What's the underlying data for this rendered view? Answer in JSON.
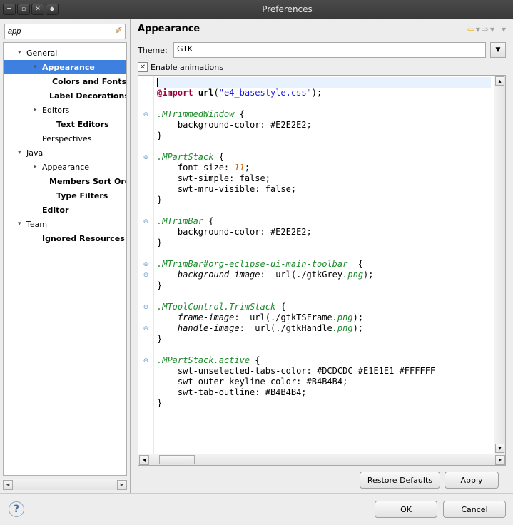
{
  "window": {
    "title": "Preferences"
  },
  "filter": {
    "value": "app"
  },
  "tree": [
    {
      "label": "General",
      "level": 1,
      "twisty": "▾",
      "interact": true,
      "bold": false
    },
    {
      "label": "Appearance",
      "level": 2,
      "twisty": "▾",
      "interact": true,
      "bold": true,
      "selected": true
    },
    {
      "label": "Colors and Fonts",
      "level": 3,
      "twisty": "",
      "interact": true,
      "bold": true
    },
    {
      "label": "Label Decorations",
      "level": 3,
      "twisty": "",
      "interact": true,
      "bold": true
    },
    {
      "label": "Editors",
      "level": 2,
      "twisty": "▸",
      "interact": true,
      "bold": false
    },
    {
      "label": "Text Editors",
      "level": 3,
      "twisty": "",
      "interact": true,
      "bold": true
    },
    {
      "label": "Perspectives",
      "level": 2,
      "twisty": "",
      "interact": true,
      "bold": false
    },
    {
      "label": "Java",
      "level": 1,
      "twisty": "▾",
      "interact": true,
      "bold": false
    },
    {
      "label": "Appearance",
      "level": 2,
      "twisty": "▸",
      "interact": true,
      "bold": false
    },
    {
      "label": "Members Sort Order",
      "level": 3,
      "twisty": "",
      "interact": true,
      "bold": true
    },
    {
      "label": "Type Filters",
      "level": 3,
      "twisty": "",
      "interact": true,
      "bold": true
    },
    {
      "label": "Editor",
      "level": 2,
      "twisty": "",
      "interact": true,
      "bold": true
    },
    {
      "label": "Team",
      "level": 1,
      "twisty": "▾",
      "interact": true,
      "bold": false
    },
    {
      "label": "Ignored Resources",
      "level": 2,
      "twisty": "",
      "interact": true,
      "bold": true
    }
  ],
  "page": {
    "title": "Appearance",
    "theme_label": "Theme:",
    "theme_value": "GTK",
    "enable_anim_prefix": "E",
    "enable_anim_rest": "nable animations",
    "enable_anim_checked": true,
    "restore": "Restore Defaults",
    "apply": "Apply"
  },
  "code": {
    "l1": {
      "a": "@import",
      "b": "url",
      "c": "\"e4_basestyle.css\""
    },
    "s1": ".MTrimmedWindow",
    "p1": "background-color: #E2E2E2;",
    "s2": ".MPartStack",
    "p2a": "font-size: ",
    "p2a_num": "11",
    "p2b": "swt-simple: false;",
    "p2c": "swt-mru-visible: false;",
    "s3": ".MTrimBar",
    "p3": "background-color: #E2E2E2;",
    "s4": ".MTrimBar#org-eclipse-ui-main-toolbar",
    "p4_prop": "background-image",
    "p4_url_arg": "./gtkGrey",
    "p4_ext": ".png",
    "s5": ".MToolControl.TrimStack",
    "p5a_prop": "frame-image",
    "p5a_arg": "./gtkTSFrame",
    "p5a_ext": ".png",
    "p5b_prop": "handle-image",
    "p5b_arg": "./gtkHandle",
    "p5b_ext": ".png",
    "s6": ".MPartStack.active",
    "p6a": "swt-unselected-tabs-color: #DCDCDC #E1E1E1 #FFFFFF",
    "p6b": "swt-outer-keyline-color: #B4B4B4;",
    "p6c": "swt-tab-outline: #B4B4B4;"
  },
  "footer": {
    "ok": "OK",
    "cancel": "Cancel"
  }
}
